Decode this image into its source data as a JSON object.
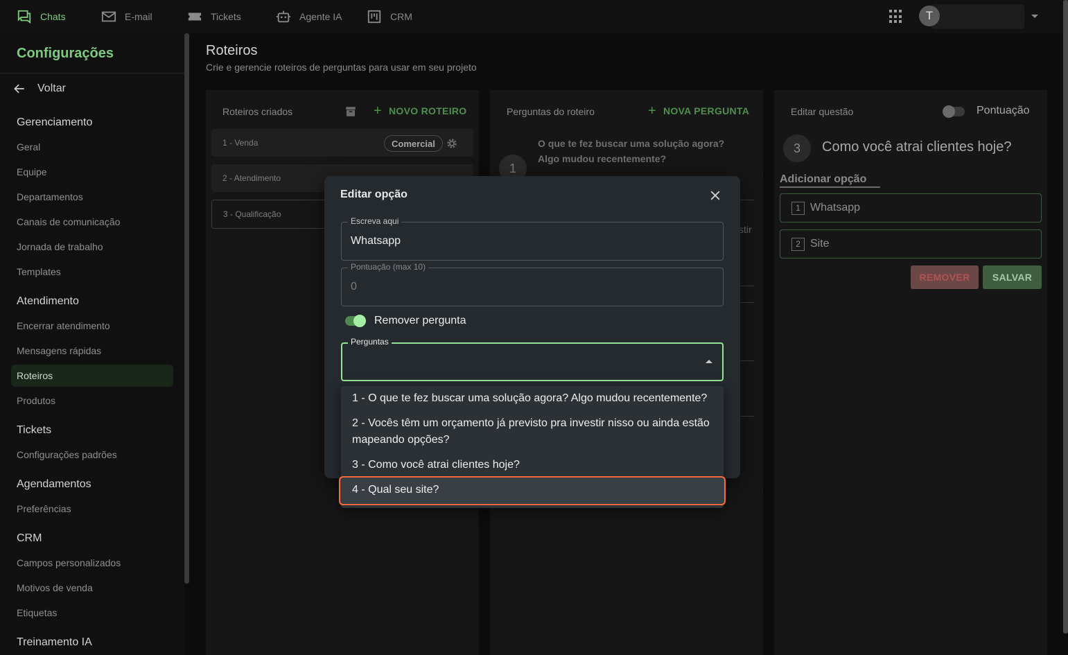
{
  "topnav": {
    "items": [
      {
        "label": "Chats",
        "icon": "chat-icon",
        "active": true
      },
      {
        "label": "E-mail",
        "icon": "mail-icon"
      },
      {
        "label": "Tickets",
        "icon": "ticket-icon"
      },
      {
        "label": "Agente IA",
        "icon": "robot-icon"
      },
      {
        "label": "CRM",
        "icon": "kanban-icon"
      }
    ],
    "avatar_initial": "T"
  },
  "sidebar": {
    "title": "Configurações",
    "back_label": "Voltar",
    "sections": [
      {
        "heading": "Gerenciamento",
        "items": [
          "Geral",
          "Equipe",
          "Departamentos",
          "Canais de comunicação",
          "Jornada de trabalho",
          "Templates"
        ]
      },
      {
        "heading": "Atendimento",
        "items": [
          "Encerrar atendimento",
          "Mensagens rápidas",
          "Roteiros",
          "Produtos"
        ],
        "active": "Roteiros"
      },
      {
        "heading": "Tickets",
        "items": [
          "Configurações padrões"
        ]
      },
      {
        "heading": "Agendamentos",
        "items": [
          "Preferências"
        ]
      },
      {
        "heading": "CRM",
        "items": [
          "Campos personalizados",
          "Motivos de venda",
          "Etiquetas"
        ]
      },
      {
        "heading": "Treinamento IA",
        "items": []
      }
    ]
  },
  "page": {
    "title": "Roteiros",
    "subtitle": "Crie e gerencie roteiros de perguntas para usar em seu projeto"
  },
  "scripts_panel": {
    "header": "Roteiros criados",
    "new_button": "NOVO ROTEIRO",
    "items": [
      {
        "label": "1 - Venda",
        "tag": "Comercial"
      },
      {
        "label": "2 - Atendimento"
      },
      {
        "label": "3 - Qualificação",
        "selected": true
      }
    ]
  },
  "questions_panel": {
    "header": "Perguntas do roteiro",
    "new_button": "NOVA PERGUNTA",
    "first_number": "1",
    "first_question": "O que te fez buscar uma solução agora? Algo mudou recentemente?",
    "partial_text": "stir"
  },
  "edit_panel": {
    "header": "Editar questão",
    "score_toggle_label": "Pontuação",
    "question_number": "3",
    "question_text": "Como você atrai clientes hoje?",
    "add_option_label": "Adicionar opção",
    "options": [
      {
        "n": "1",
        "label": "Whatsapp"
      },
      {
        "n": "2",
        "label": "Site"
      }
    ],
    "remove_button": "REMOVER",
    "save_button": "SALVAR"
  },
  "dialog": {
    "title": "Editar opção",
    "text_field_label": "Escreva aqui",
    "text_field_value": "Whatsapp",
    "score_field_label": "Pontuação (max 10)",
    "score_field_value": "0",
    "switch_label": "Remover pergunta",
    "switch_on": true,
    "select_label": "Perguntas",
    "menu_options": [
      "1 - O que te fez buscar uma solução agora? Algo mudou recentemente?",
      "2 - Vocês têm um orçamento já previsto pra investir nisso ou ainda estão mapeando opções?",
      "3 - Como você atrai clientes hoje?",
      "4 - Qual seu site?"
    ],
    "highlighted_option": "4 - Qual seu site?"
  },
  "colors": {
    "accent_green": "#7fc97f",
    "focus_green": "#93e493",
    "highlight_orange": "#ff6a3d",
    "remove_red": "#b35252"
  }
}
